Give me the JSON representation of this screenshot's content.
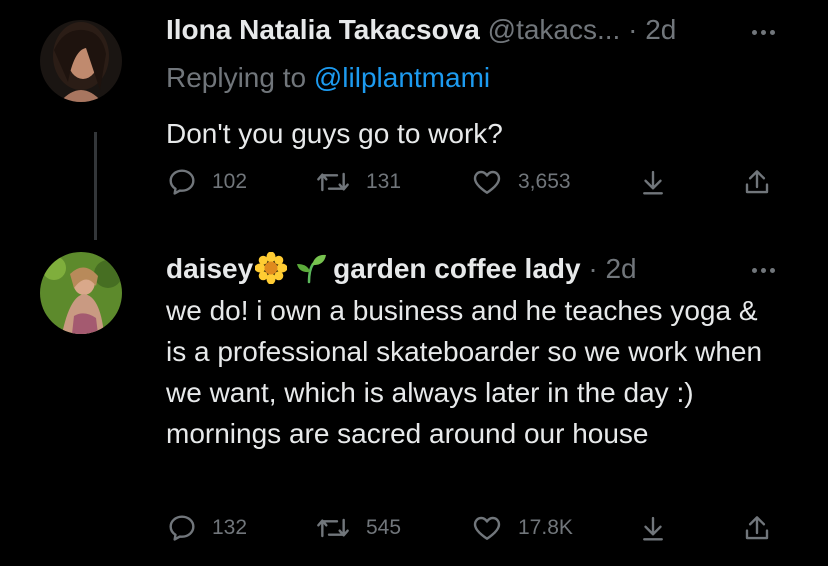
{
  "tweets": [
    {
      "name": "Ilona Natalia Takacsova",
      "handle": "@takacs...",
      "time": "2d",
      "replying_prefix": "Replying to",
      "replying_to": "@lilplantmami",
      "text": "Don't you guys go to work?",
      "replies": "102",
      "retweets": "131",
      "likes": "3,653"
    },
    {
      "name_part1": "daisey",
      "name_part2": "garden coffee lady",
      "time": "2d",
      "text": "we do! i own a business and he teaches yoga & is a professional skateboarder so we work when we want, which is always later in the day :) mornings are sacred around our house",
      "replies": "132",
      "retweets": "545",
      "likes": "17.8K"
    }
  ],
  "colors": {
    "background": "#000000",
    "text": "#e7e9ea",
    "muted": "#71767b",
    "link": "#1d9bf0",
    "thread_line": "#333639"
  },
  "icons": [
    "reply-icon",
    "retweet-icon",
    "like-icon",
    "bookmark-icon",
    "share-icon",
    "more-icon",
    "sunflower-emoji",
    "seedling-emoji"
  ]
}
